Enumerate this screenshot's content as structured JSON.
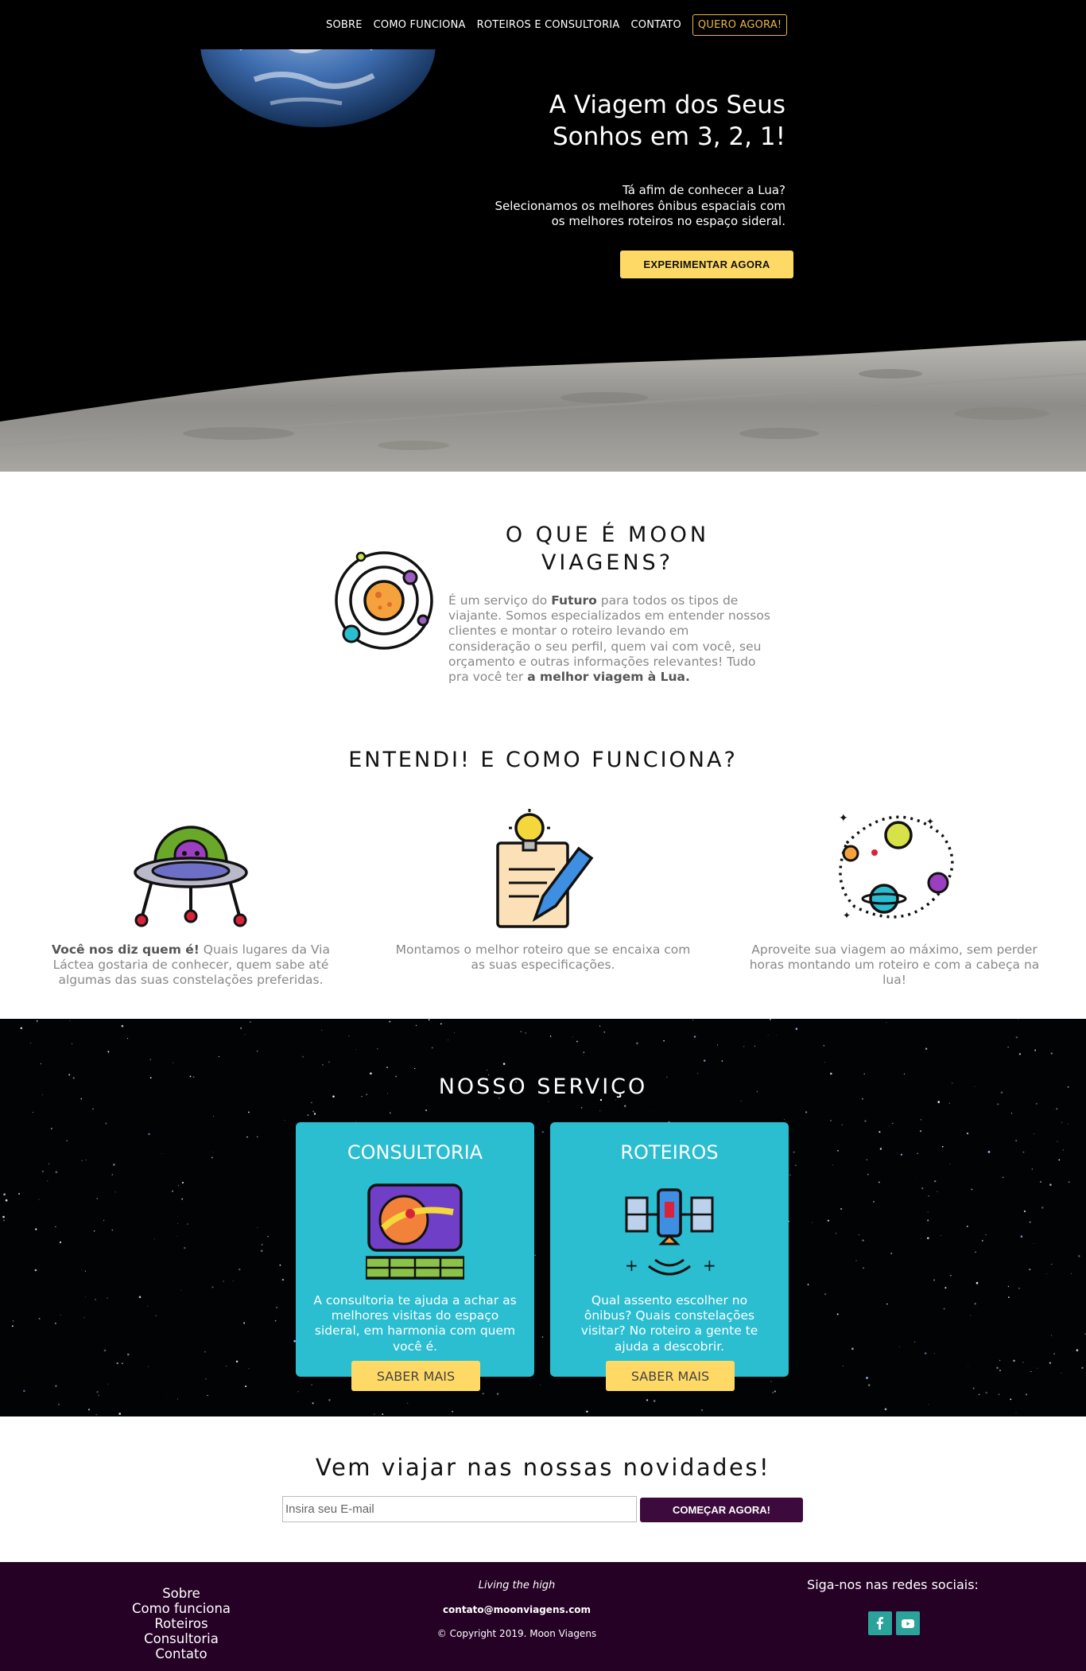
{
  "nav": {
    "items": [
      "SOBRE",
      "COMO FUNCIONA",
      "ROTEIROS E CONSULTORIA",
      "CONTATO"
    ],
    "cta": "QUERO AGORA!"
  },
  "hero": {
    "title_line1": "A Viagem dos Seus",
    "title_line2": "Sonhos em 3, 2, 1!",
    "text_line1": "Tá afim de conhecer a Lua?",
    "text_line2": "Selecionamos os melhores ônibus espaciais com",
    "text_line3": "os melhores roteiros no espaço sideral.",
    "button": "EXPERIMENTAR AGORA"
  },
  "about": {
    "title": "O QUE É MOON VIAGENS?",
    "text_1": "É um serviço do ",
    "text_bold_1": "Futuro",
    "text_2": " para todos os tipos de viajante. Somos especializados em entender nossos clientes e montar o roteiro levando em consideração o seu perfil, quem vai com você, seu orçamento e outras informações relevantes! Tudo pra você ter ",
    "text_bold_2": "a melhor viagem à Lua."
  },
  "how": {
    "title": "ENTENDI! E COMO FUNCIONA?",
    "steps": [
      {
        "bold": "Você nos diz quem é!",
        "text": " Quais lugares da Via Láctea gostaria de conhecer, quem sabe até algumas das suas constelações preferidas.",
        "icon": "ufo-alien-icon"
      },
      {
        "bold": "",
        "text": "Montamos o melhor roteiro que se encaixa com as suas especificações.",
        "icon": "idea-notebook-icon"
      },
      {
        "bold": "",
        "text": "Aproveite sua viagem ao máximo, sem perder horas montando um roteiro e com a cabeça na lua!",
        "icon": "planets-orbit-icon"
      }
    ]
  },
  "service": {
    "title": "NOSSO SERVIÇO",
    "cards": [
      {
        "title": "CONSULTORIA",
        "text": "A consultoria te ajuda a achar as melhores visitas do espaço sideral, em harmonia com quem você é.",
        "button": "SABER MAIS",
        "icon": "planet-screen-icon"
      },
      {
        "title": "ROTEIROS",
        "text": "Qual assento escolher no ônibus? Quais constelações visitar? No roteiro a gente te ajuda a descobrir.",
        "button": "SABER MAIS",
        "icon": "satellite-icon"
      }
    ]
  },
  "newsletter": {
    "title": "Vem viajar nas nossas novidades!",
    "placeholder": "Insira seu E-mail",
    "button": "COMEÇAR AGORA!"
  },
  "footer": {
    "links": [
      "Sobre",
      "Como funciona",
      "Roteiros",
      "Consultoria",
      "Contato"
    ],
    "slogan": "Living the high",
    "email": "contato@moonviagens.com",
    "copyright": "© Copyright 2019. Moon Viagens",
    "social_title": "Siga-nos nas redes sociais:",
    "social_icons": [
      "facebook-icon",
      "youtube-icon"
    ]
  },
  "colors": {
    "accent_yellow": "#ffd966",
    "nav_cta": "#e8b740",
    "card_teal": "#2bbdd0",
    "footer_bg": "#240125",
    "newsletter_button": "#3d0a3e",
    "social_teal": "#2aa39a"
  }
}
